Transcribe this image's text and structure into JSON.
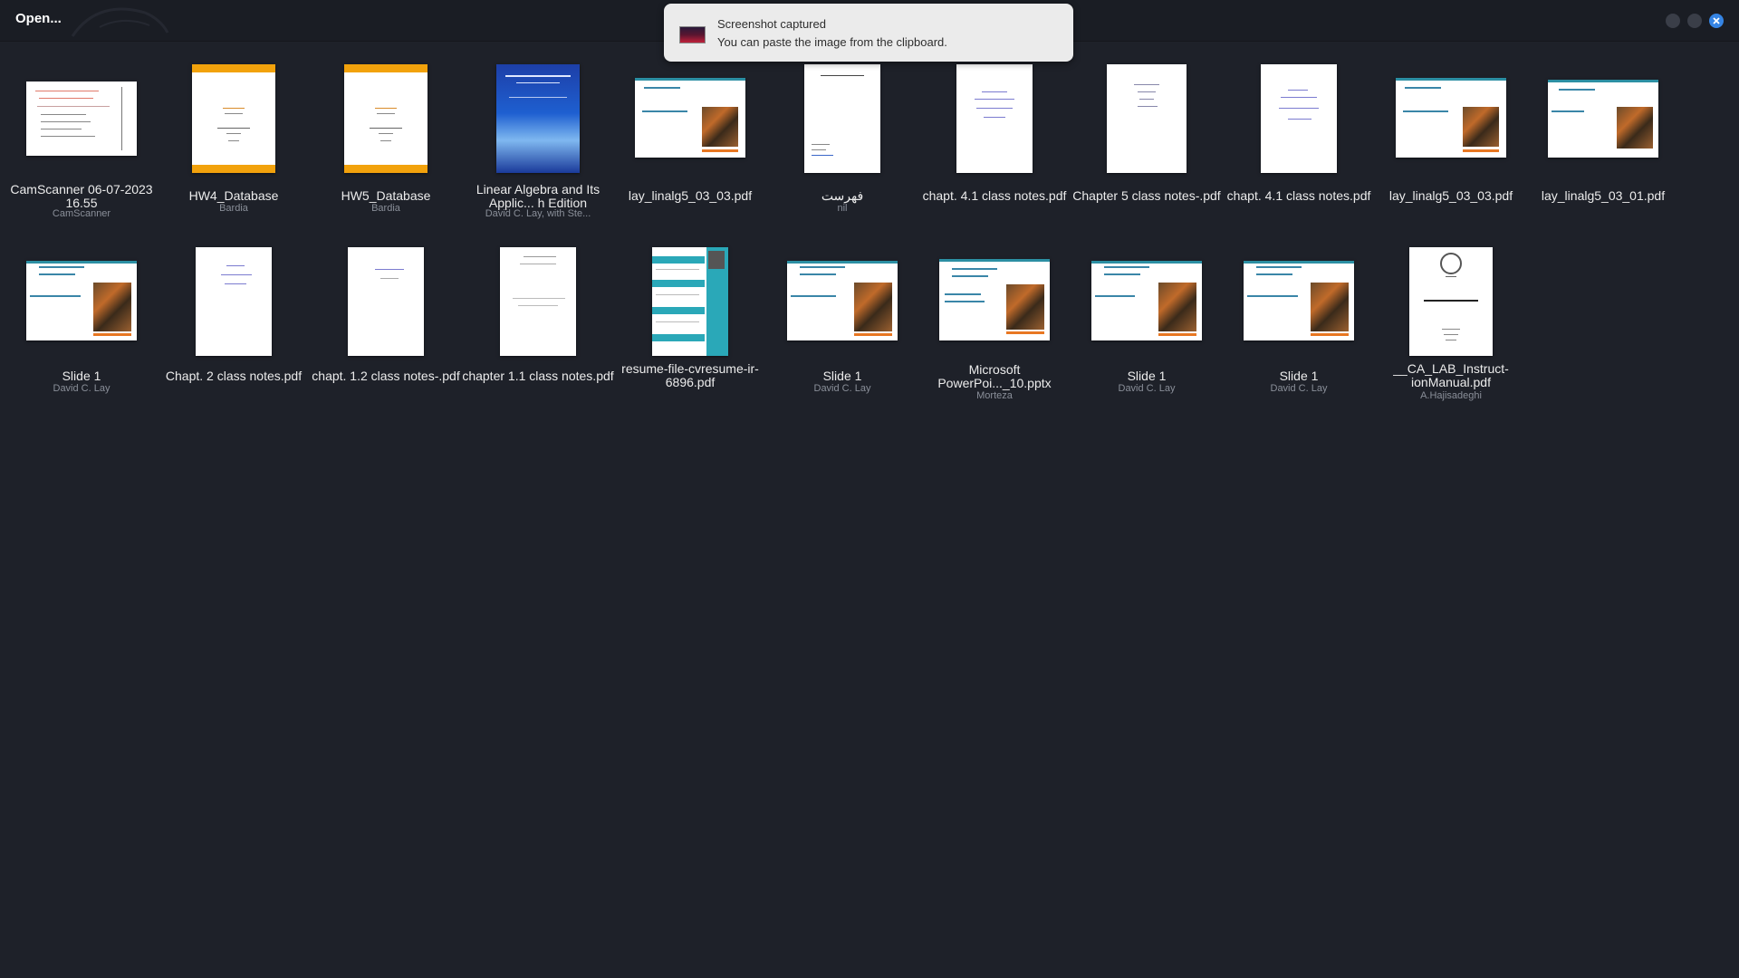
{
  "window": {
    "title": "Open..."
  },
  "toast": {
    "title": "Screenshot captured",
    "body": "You can paste the image from the clipboard."
  },
  "files": [
    {
      "name": "CamScanner 06-07-2023 16.55",
      "author": "CamScanner",
      "thumb": "scan-icon"
    },
    {
      "name": "HW4_Database",
      "author": "Bardia",
      "thumb": "document-icon"
    },
    {
      "name": "HW5_Database",
      "author": "Bardia",
      "thumb": "document-icon"
    },
    {
      "name": "Linear Algebra and Its Applic... h Edition",
      "author": "David C. Lay, with Ste...",
      "thumb": "book-icon"
    },
    {
      "name": "lay_linalg5_03_03.pdf",
      "author": "",
      "thumb": "slide-icon"
    },
    {
      "name": "فهرست",
      "author": "nil",
      "thumb": "document-icon"
    },
    {
      "name": "chapt. 4.1 class notes.pdf",
      "author": "",
      "thumb": "notes-icon"
    },
    {
      "name": "Chapter 5 class notes-.pdf",
      "author": "",
      "thumb": "notes-icon"
    },
    {
      "name": "chapt. 4.1 class notes.pdf",
      "author": "",
      "thumb": "notes-icon"
    },
    {
      "name": "lay_linalg5_03_03.pdf",
      "author": "",
      "thumb": "slide-icon"
    },
    {
      "name": "lay_linalg5_03_01.pdf",
      "author": "",
      "thumb": "slide-icon"
    },
    {
      "name": "Slide 1",
      "author": "David C. Lay",
      "thumb": "slide-icon"
    },
    {
      "name": "Chapt. 2 class notes.pdf",
      "author": "",
      "thumb": "notes-icon"
    },
    {
      "name": "chapt. 1.2 class notes-.pdf",
      "author": "",
      "thumb": "notes-icon"
    },
    {
      "name": "chapter 1.1 class notes.pdf",
      "author": "",
      "thumb": "notes-icon"
    },
    {
      "name": "resume-file-cvresume-ir-6896.pdf",
      "author": "",
      "thumb": "resume-icon"
    },
    {
      "name": "Slide 1",
      "author": "David C. Lay",
      "thumb": "slide-icon"
    },
    {
      "name": "Microsoft PowerPoi..._10.pptx",
      "author": "Morteza",
      "thumb": "slide-icon"
    },
    {
      "name": "Slide 1",
      "author": "David C. Lay",
      "thumb": "slide-icon"
    },
    {
      "name": "Slide 1",
      "author": "David C. Lay",
      "thumb": "slide-icon"
    },
    {
      "name": "__CA_LAB_Instruct-ionManual.pdf",
      "author": "A.Hajisadeghi",
      "thumb": "manual-icon"
    }
  ]
}
